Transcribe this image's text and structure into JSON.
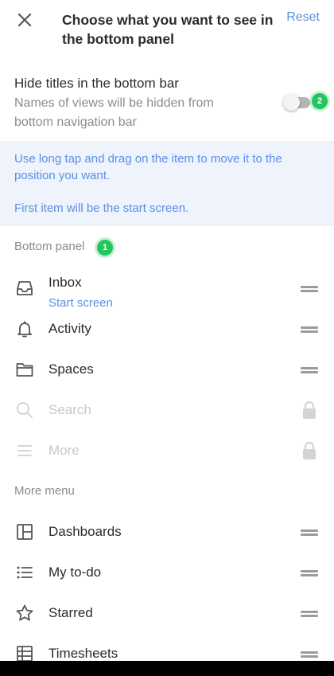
{
  "header": {
    "title": "Choose what you want to see in the bottom panel",
    "reset_label": "Reset",
    "close_icon": "close-icon"
  },
  "hide_titles": {
    "title": "Hide titles in the bottom bar",
    "description": "Names of views will be hidden from bottom navigation bar",
    "enabled": false,
    "badge": "2"
  },
  "info": {
    "line1": "Use long tap and drag on the item to move it to the position you want.",
    "line2": "First item will be the start screen."
  },
  "bottom_panel": {
    "label": "Bottom panel",
    "badge": "1",
    "items": [
      {
        "label": "Inbox",
        "sublabel": "Start screen",
        "icon": "inbox-icon",
        "control": "drag-handle",
        "disabled": false
      },
      {
        "label": "Activity",
        "icon": "bell-icon",
        "control": "drag-handle",
        "disabled": false
      },
      {
        "label": "Spaces",
        "icon": "folder-icon",
        "control": "drag-handle",
        "disabled": false
      },
      {
        "label": "Search",
        "icon": "search-icon",
        "control": "lock",
        "disabled": true
      },
      {
        "label": "More",
        "icon": "menu-icon",
        "control": "lock",
        "disabled": true
      }
    ]
  },
  "more_menu": {
    "label": "More menu",
    "items": [
      {
        "label": "Dashboards",
        "icon": "dashboard-icon",
        "control": "drag-handle"
      },
      {
        "label": "My to-do",
        "icon": "list-icon",
        "control": "drag-handle"
      },
      {
        "label": "Starred",
        "icon": "star-icon",
        "control": "drag-handle"
      },
      {
        "label": "Timesheets",
        "icon": "table-icon",
        "control": "drag-handle"
      }
    ]
  },
  "colors": {
    "accent": "#5b8ee6",
    "badge": "#22c55e",
    "info_background": "#eef3fc",
    "disabled_text": "#c8c8c8"
  }
}
